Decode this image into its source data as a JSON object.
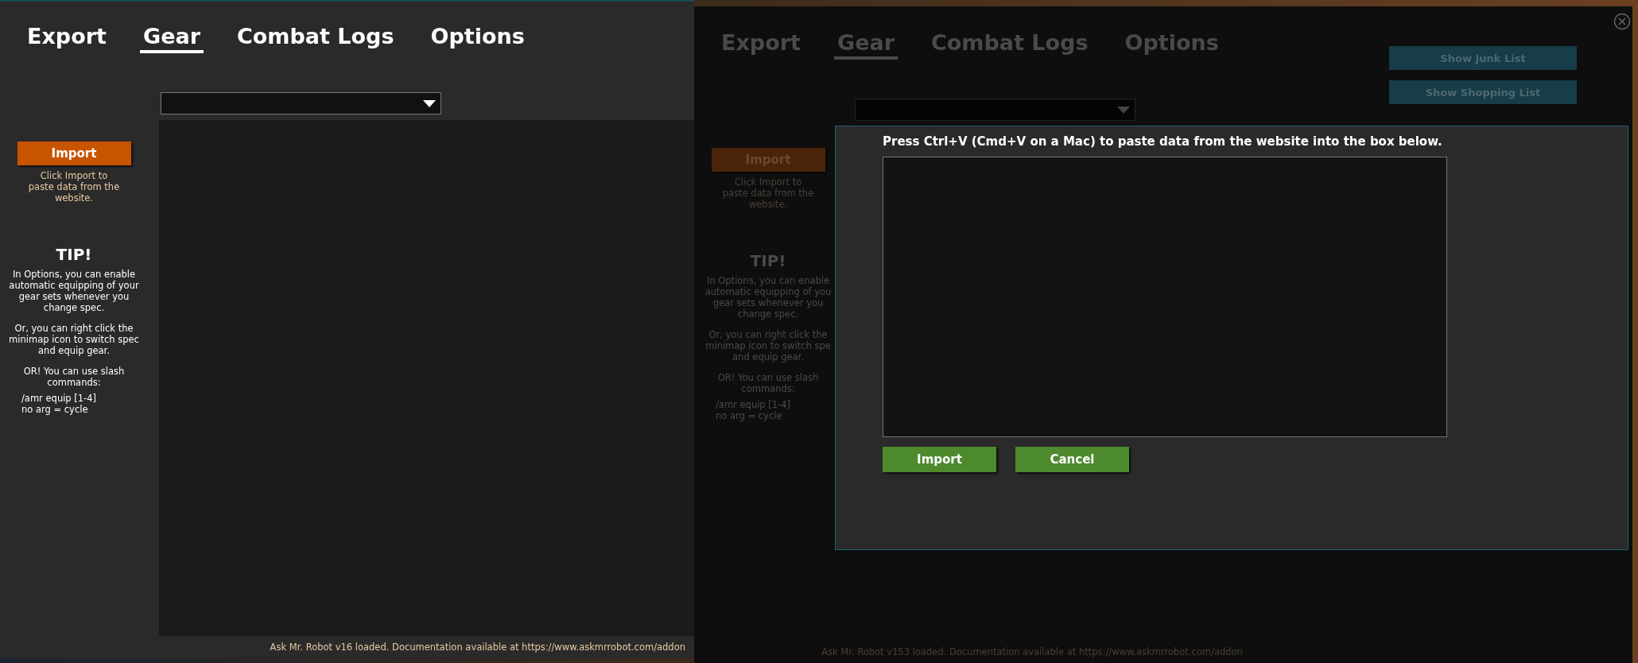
{
  "left_window": {
    "tabs": [
      {
        "label": "Export",
        "selected": false
      },
      {
        "label": "Gear",
        "selected": true
      },
      {
        "label": "Combat Logs",
        "selected": false
      },
      {
        "label": "Options",
        "selected": false
      }
    ],
    "import_button": "Import",
    "import_hint": [
      "Click Import to",
      "paste data from the",
      "website."
    ],
    "tip": {
      "title": "TIP!",
      "paragraphs": [
        [
          "In Options, you can enable",
          "automatic equipping of your",
          "gear sets whenever you",
          "change spec."
        ],
        [
          "Or, you can right click the",
          "minimap icon to switch spec",
          "and equip gear."
        ],
        [
          "OR! You can use slash",
          "commands:"
        ]
      ],
      "commands": [
        "/amr equip [1-4]",
        "no arg = cycle"
      ]
    },
    "status": "Ask Mr. Robot v16 loaded. Documentation available at https://www.askmrrobot.com/addon"
  },
  "right_window": {
    "tabs": [
      {
        "label": "Export",
        "selected": false
      },
      {
        "label": "Gear",
        "selected": true
      },
      {
        "label": "Combat Logs",
        "selected": false
      },
      {
        "label": "Options",
        "selected": false
      }
    ],
    "import_button": "Import",
    "import_hint": [
      "Click Import to",
      "paste data from the",
      "website."
    ],
    "tip": {
      "title": "TIP!",
      "paragraphs": [
        [
          "In Options, you can enable",
          "automatic equipping of you",
          "gear sets whenever you",
          "change spec."
        ],
        [
          "Or, you can right click the",
          "minimap icon to switch spe",
          "and equip gear."
        ],
        [
          "OR! You can use slash",
          "commands:"
        ]
      ],
      "commands": [
        "/amr equip [1-4]",
        "no arg = cycle"
      ]
    },
    "side_buttons": [
      "Show Junk List",
      "Show Shopping List"
    ],
    "dialog": {
      "instruction": "Press Ctrl+V (Cmd+V on a Mac) to paste data from the website into the box below.",
      "buttons": [
        "Import",
        "Cancel"
      ]
    },
    "status": "Ask Mr. Robot v153 loaded. Documentation available at https://www.askmrrobot.com/addon"
  }
}
